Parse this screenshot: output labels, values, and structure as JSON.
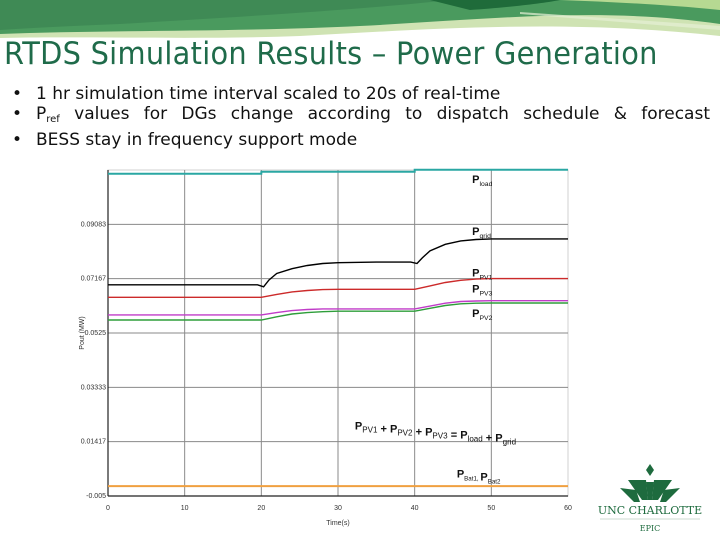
{
  "slide": {
    "title": "RTDS Simulation Results – Power Generation",
    "bullets": [
      {
        "text": "1 hr simulation time interval scaled to 20s of real-time"
      },
      {
        "prefix": "P",
        "sub": "ref",
        "text": " values for DGs change according to dispatch schedule & forecast"
      },
      {
        "text": "BESS stay in frequency support mode"
      }
    ],
    "bullet_glyph": "•",
    "colors": {
      "title": "#1f6b4a",
      "banner_dark": "#2e7d4f",
      "banner_light": "#a8d08d"
    }
  },
  "logo": {
    "name": "UNC CHARLOTTE",
    "sub": "EPIC",
    "color": "#1e6b3e"
  },
  "chart_data": {
    "type": "line",
    "title": "",
    "xlabel": "Time(s)",
    "ylabel": "Pout (MW)",
    "xlim": [
      0,
      60
    ],
    "ylim": [
      -0.005,
      0.11
    ],
    "xticks": [
      0,
      10,
      20,
      30,
      40,
      50,
      60
    ],
    "xtick_labels": [
      "0",
      "10",
      "20",
      "30",
      "40",
      "50",
      "60"
    ],
    "yticks": [
      -0.005,
      0.01417,
      0.03333,
      0.0525,
      0.07167,
      0.09083
    ],
    "ytick_labels": [
      "-0.005",
      "0.01417",
      "0.03333",
      "0.0525",
      "0.07167",
      "0.09083"
    ],
    "grid": true,
    "series": [
      {
        "name": "Pload",
        "color": "#2aa7a3",
        "x": [
          0,
          20,
          20.01,
          40,
          40.01,
          60
        ],
        "y": [
          0.1087,
          0.1087,
          0.1094,
          0.1094,
          0.1101,
          0.1101
        ]
      },
      {
        "name": "Pgrid",
        "color": "#000000",
        "x": [
          0,
          19.5,
          20.3,
          21,
          22,
          24,
          26,
          28,
          30,
          35,
          39.5,
          40.3,
          41,
          42,
          44,
          46,
          48,
          50,
          60
        ],
        "y": [
          0.0695,
          0.0695,
          0.0688,
          0.0712,
          0.0735,
          0.0752,
          0.0763,
          0.077,
          0.0773,
          0.0775,
          0.0775,
          0.077,
          0.079,
          0.0815,
          0.0838,
          0.085,
          0.0855,
          0.0857,
          0.0857
        ]
      },
      {
        "name": "PPV1",
        "color": "#cc2a2a",
        "x": [
          0,
          20,
          22,
          24,
          26,
          28,
          30,
          40,
          42,
          44,
          46,
          48,
          50,
          60
        ],
        "y": [
          0.0651,
          0.0651,
          0.0661,
          0.067,
          0.0675,
          0.0678,
          0.0679,
          0.0679,
          0.0691,
          0.0703,
          0.0711,
          0.0715,
          0.0717,
          0.0717
        ]
      },
      {
        "name": "PPV3",
        "color": "#c03cc8",
        "x": [
          0,
          20,
          22,
          24,
          26,
          28,
          30,
          40,
          42,
          44,
          46,
          48,
          50,
          60
        ],
        "y": [
          0.0589,
          0.0589,
          0.0597,
          0.0604,
          0.0608,
          0.061,
          0.061,
          0.061,
          0.062,
          0.063,
          0.0636,
          0.0638,
          0.0639,
          0.0639
        ]
      },
      {
        "name": "PPV2",
        "color": "#2e9e3a",
        "x": [
          0,
          20,
          22,
          24,
          26,
          28,
          30,
          40,
          42,
          44,
          46,
          48,
          50,
          60
        ],
        "y": [
          0.0571,
          0.0571,
          0.0582,
          0.0592,
          0.0597,
          0.06,
          0.0602,
          0.0602,
          0.0612,
          0.0622,
          0.0628,
          0.063,
          0.0631,
          0.0631
        ]
      },
      {
        "name": "PBat1, PBat2",
        "color": "#f0a040",
        "x": [
          0,
          60
        ],
        "y": [
          -0.0015,
          -0.0015
        ]
      }
    ],
    "annotations": [
      {
        "main": "P",
        "sub": "load",
        "x": 47.5,
        "y": 0.1055
      },
      {
        "main": "P",
        "sub": "grid",
        "x": 47.5,
        "y": 0.087
      },
      {
        "main": "P",
        "sub": "PV1",
        "x": 47.5,
        "y": 0.0724
      },
      {
        "main": "P",
        "sub": "PV3",
        "x": 47.5,
        "y": 0.0668
      },
      {
        "main": "P",
        "sub": "PV2",
        "x": 47.5,
        "y": 0.0582
      },
      {
        "main": "P",
        "sub": "Bat1, ",
        "main2": "P",
        "sub2": "Bat2",
        "x": 45.5,
        "y": 0.0015
      }
    ],
    "equation": [
      {
        "main": "P",
        "sub": "PV1"
      },
      {
        "op": " + "
      },
      {
        "main": "P",
        "sub": "PV2"
      },
      {
        "op": " + "
      },
      {
        "main": "P",
        "sub": "PV3"
      },
      {
        "op": " = "
      },
      {
        "main": "P",
        "sub": "load"
      },
      {
        "op": " + "
      },
      {
        "main": "P",
        "sub": "grid"
      }
    ]
  }
}
